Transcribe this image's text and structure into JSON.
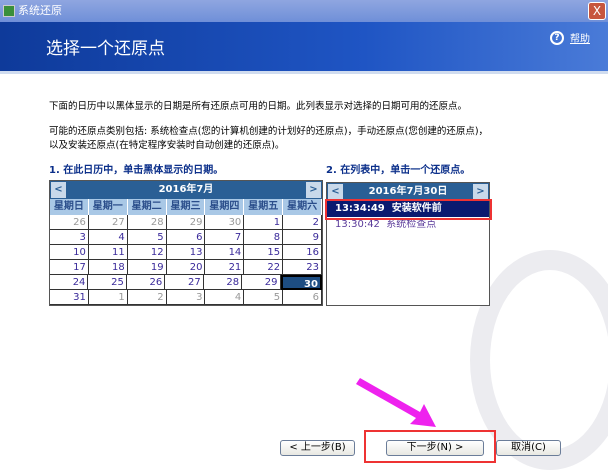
{
  "window": {
    "title": "系统还原",
    "close": "X"
  },
  "header": {
    "title": "选择一个还原点",
    "help": "帮助",
    "help_icon": "?"
  },
  "desc": {
    "p1": "下面的日历中以黑体显示的日期是所有还原点可用的日期。此列表显示对选择的日期可用的还原点。",
    "p2a": "可能的还原点类别包括: 系统检查点(您的计算机创建的计划好的还原点)，手动还原点(您创建的还原点)，",
    "p2b": "以及安装还原点(在特定程序安装时自动创建的还原点)。"
  },
  "step1": "1. 在此日历中，单击黑体显示的日期。",
  "step2": "2. 在列表中，单击一个还原点。",
  "calendar": {
    "month": "2016年7月",
    "prev": "<",
    "next": ">",
    "days": [
      "星期日",
      "星期一",
      "星期二",
      "星期三",
      "星期四",
      "星期五",
      "星期六"
    ],
    "weeks": [
      [
        "26",
        "27",
        "28",
        "29",
        "30",
        "1",
        "2"
      ],
      [
        "3",
        "4",
        "5",
        "6",
        "7",
        "8",
        "9"
      ],
      [
        "10",
        "11",
        "12",
        "13",
        "14",
        "15",
        "16"
      ],
      [
        "17",
        "18",
        "19",
        "20",
        "21",
        "22",
        "23"
      ],
      [
        "24",
        "25",
        "26",
        "27",
        "28",
        "29",
        "30"
      ],
      [
        "31",
        "1",
        "2",
        "3",
        "4",
        "5",
        "6"
      ]
    ],
    "selected": "30"
  },
  "list": {
    "date": "2016年7月30日",
    "prev": "<",
    "next": ">",
    "items": [
      {
        "time": "13:34:49",
        "name": "安装软件前"
      },
      {
        "time": "13:30:42",
        "name": "系统检查点"
      }
    ]
  },
  "buttons": {
    "back": "< 上一步(B)",
    "next": "下一步(N) >",
    "cancel": "取消(C)"
  }
}
